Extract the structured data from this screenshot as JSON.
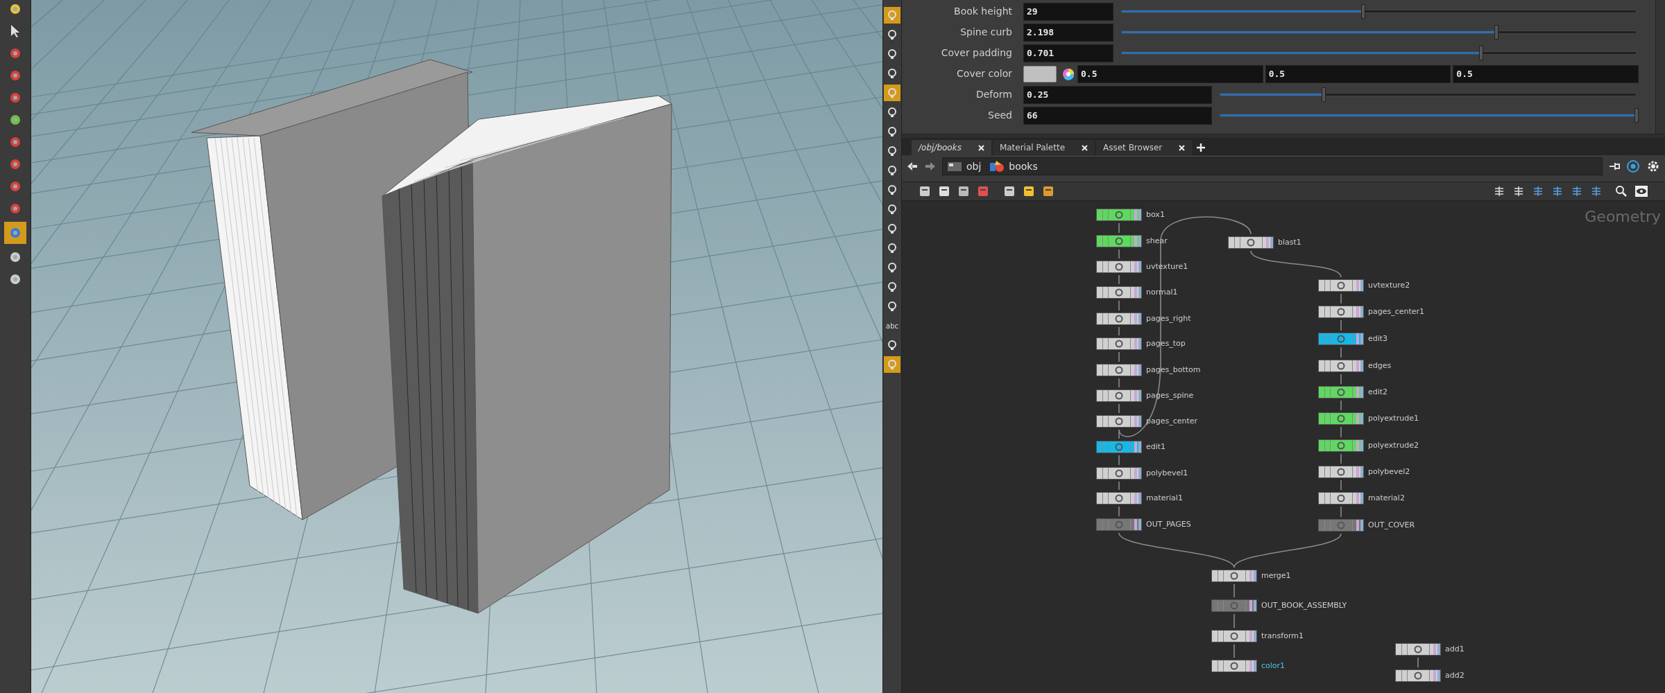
{
  "left_toolbar": {
    "tools": [
      {
        "selected": false
      },
      {
        "selected": false
      },
      {
        "selected": false
      },
      {
        "selected": false
      },
      {
        "selected": false
      },
      {
        "selected": false
      },
      {
        "selected": false
      },
      {
        "selected": false
      },
      {
        "selected": false
      },
      {
        "selected": false
      },
      {
        "selected": true
      },
      {
        "selected": false
      },
      {
        "selected": false
      }
    ]
  },
  "right_toolbar": {
    "tools": [
      {
        "kind": "icon",
        "selected": true
      },
      {
        "kind": "icon",
        "selected": false
      },
      {
        "kind": "icon",
        "selected": false
      },
      {
        "kind": "icon",
        "selected": false
      },
      {
        "kind": "icon",
        "selected": true
      },
      {
        "kind": "icon",
        "selected": false
      },
      {
        "kind": "icon",
        "selected": false
      },
      {
        "kind": "icon",
        "selected": false
      },
      {
        "kind": "icon",
        "selected": false
      },
      {
        "kind": "icon",
        "selected": false
      },
      {
        "kind": "icon",
        "selected": false
      },
      {
        "kind": "icon",
        "selected": false
      },
      {
        "kind": "icon",
        "selected": false
      },
      {
        "kind": "icon",
        "selected": false
      },
      {
        "kind": "icon",
        "selected": false
      },
      {
        "kind": "icon",
        "selected": false
      },
      {
        "kind": "text",
        "label": "abc",
        "selected": false
      },
      {
        "kind": "icon",
        "selected": false
      },
      {
        "kind": "icon",
        "selected": true
      }
    ]
  },
  "parameters": [
    {
      "kind": "slider",
      "label": "Book height",
      "value": "29",
      "level": 0.47
    },
    {
      "kind": "slider",
      "label": "Spine curb",
      "value": "2.198",
      "level": 0.73
    },
    {
      "kind": "slider",
      "label": "Cover padding",
      "value": "0.701",
      "level": 0.7
    },
    {
      "kind": "color",
      "label": "Cover color",
      "color": "#c0c0c0",
      "values": [
        "0.5",
        "0.5",
        "0.5"
      ]
    },
    {
      "kind": "wide_slider",
      "label": "Deform",
      "value": "0.25",
      "level": 0.25
    },
    {
      "kind": "wide_slider",
      "label": "Seed",
      "value": "66",
      "level": 1
    }
  ],
  "network": {
    "tabs": [
      {
        "label": "/obj/books",
        "selected": true
      },
      {
        "label": "Material Palette",
        "selected": false
      },
      {
        "label": "Asset Browser",
        "selected": false
      }
    ],
    "path": [
      "obj",
      "books"
    ],
    "context_label": "Geometry",
    "nodes": [
      {
        "name": "box1",
        "color": "#5fd85f",
        "selected": false
      },
      {
        "name": "shear",
        "color": "#5fd85f",
        "selected": false
      },
      {
        "name": "uvtexture1",
        "color": "#d0d0d0",
        "selected": false
      },
      {
        "name": "normal1",
        "color": "#d0d0d0",
        "selected": false
      },
      {
        "name": "pages_right",
        "color": "#d0d0d0",
        "selected": false
      },
      {
        "name": "pages_top",
        "color": "#d0d0d0",
        "selected": false
      },
      {
        "name": "pages_bottom",
        "color": "#d0d0d0",
        "selected": false
      },
      {
        "name": "pages_spine",
        "color": "#d0d0d0",
        "selected": false
      },
      {
        "name": "pages_center",
        "color": "#d0d0d0",
        "selected": false
      },
      {
        "name": "edit1",
        "color": "#17b8e6",
        "selected": false
      },
      {
        "name": "polybevel1",
        "color": "#d0d0d0",
        "selected": false
      },
      {
        "name": "material1",
        "color": "#d0d0d0",
        "selected": false
      },
      {
        "name": "OUT_PAGES",
        "color": "#777777",
        "selected": false
      },
      {
        "name": "blast1",
        "color": "#d0d0d0",
        "selected": false
      },
      {
        "name": "uvtexture2",
        "color": "#d0d0d0",
        "selected": false
      },
      {
        "name": "pages_center1",
        "color": "#d0d0d0",
        "selected": false
      },
      {
        "name": "edit3",
        "color": "#17b8e6",
        "selected": false
      },
      {
        "name": "edges",
        "color": "#d0d0d0",
        "selected": false
      },
      {
        "name": "edit2",
        "color": "#5fd85f",
        "selected": false
      },
      {
        "name": "polyextrude1",
        "color": "#5fd85f",
        "selected": false
      },
      {
        "name": "polyextrude2",
        "color": "#5fd85f",
        "selected": false
      },
      {
        "name": "polybevel2",
        "color": "#d0d0d0",
        "selected": false
      },
      {
        "name": "material2",
        "color": "#d0d0d0",
        "selected": false
      },
      {
        "name": "OUT_COVER",
        "color": "#777777",
        "selected": false
      },
      {
        "name": "merge1",
        "color": "#d0d0d0",
        "selected": false
      },
      {
        "name": "OUT_BOOK_ASSEMBLY",
        "color": "#777777",
        "selected": false
      },
      {
        "name": "transform1",
        "color": "#d0d0d0",
        "selected": false
      },
      {
        "name": "color1",
        "color": "#d0d0d0",
        "selected": true
      },
      {
        "name": "add1",
        "color": "#d0d0d0",
        "selected": false
      },
      {
        "name": "add2",
        "color": "#d0d0d0",
        "selected": false
      }
    ]
  }
}
